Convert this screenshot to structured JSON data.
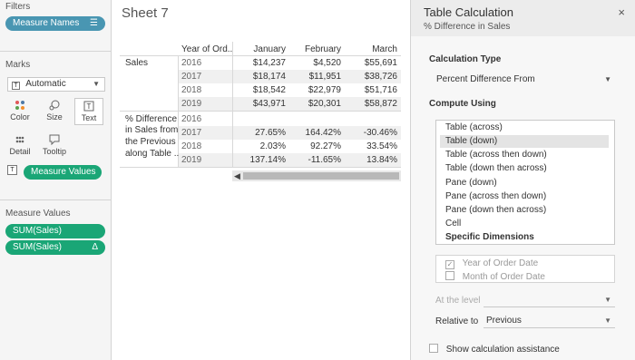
{
  "filters": {
    "title": "Filters",
    "pill": {
      "label": "Measure Names",
      "icon": "filter-list-icon"
    }
  },
  "marks": {
    "title": "Marks",
    "type": {
      "label": "Automatic"
    },
    "buttons": [
      {
        "label": "Color",
        "icon": "color-dots-icon"
      },
      {
        "label": "Size",
        "icon": "size-icon"
      },
      {
        "label": "Text",
        "icon": "text-icon"
      },
      {
        "label": "Detail",
        "icon": "detail-icon"
      },
      {
        "label": "Tooltip",
        "icon": "tooltip-icon"
      }
    ],
    "pill": {
      "label": "Measure Values"
    }
  },
  "measure_values": {
    "title": "Measure Values",
    "pills": [
      {
        "label": "SUM(Sales)",
        "has_delta": false
      },
      {
        "label": "SUM(Sales)",
        "has_delta": true,
        "delta": "Δ"
      }
    ]
  },
  "sheet": {
    "title": "Sheet 7",
    "year_header": "Year of Ord..",
    "months": [
      "January",
      "February",
      "March"
    ],
    "sections": [
      {
        "label": "Sales",
        "rows": [
          {
            "year": "2016",
            "values": [
              "$14,237",
              "$4,520",
              "$55,691"
            ]
          },
          {
            "year": "2017",
            "values": [
              "$18,174",
              "$11,951",
              "$38,726"
            ]
          },
          {
            "year": "2018",
            "values": [
              "$18,542",
              "$22,979",
              "$51,716"
            ]
          },
          {
            "year": "2019",
            "values": [
              "$43,971",
              "$20,301",
              "$58,872"
            ]
          }
        ]
      },
      {
        "label_lines": [
          "% Difference",
          "in Sales from",
          "the Previous",
          "along Table .."
        ],
        "rows": [
          {
            "year": "2016",
            "values": [
              "",
              "",
              ""
            ]
          },
          {
            "year": "2017",
            "values": [
              "27.65%",
              "164.42%",
              "-30.46%"
            ]
          },
          {
            "year": "2018",
            "values": [
              "2.03%",
              "92.27%",
              "33.54%"
            ]
          },
          {
            "year": "2019",
            "values": [
              "137.14%",
              "-11.65%",
              "13.84%"
            ]
          }
        ]
      }
    ]
  },
  "table_calc": {
    "title": "Table Calculation",
    "subtitle": "% Difference in Sales",
    "calc_type_label": "Calculation Type",
    "calc_type_value": "Percent Difference From",
    "compute_using_label": "Compute Using",
    "compute_options": [
      {
        "label": "Table (across)",
        "selected": false,
        "bold": false
      },
      {
        "label": "Table (down)",
        "selected": true,
        "bold": false
      },
      {
        "label": "Table (across then down)",
        "selected": false,
        "bold": false
      },
      {
        "label": "Table (down then across)",
        "selected": false,
        "bold": false
      },
      {
        "label": "Pane (down)",
        "selected": false,
        "bold": false
      },
      {
        "label": "Pane (across then down)",
        "selected": false,
        "bold": false
      },
      {
        "label": "Pane (down then across)",
        "selected": false,
        "bold": false
      },
      {
        "label": "Cell",
        "selected": false,
        "bold": false
      },
      {
        "label": "Specific Dimensions",
        "selected": false,
        "bold": true
      }
    ],
    "dimensions": [
      {
        "label": "Year of Order Date",
        "checked": true
      },
      {
        "label": "Month of Order Date",
        "checked": false
      }
    ],
    "at_level_label": "At the level",
    "at_level_value": "",
    "relative_to_label": "Relative to",
    "relative_to_value": "Previous",
    "assist_label": "Show calculation assistance"
  }
}
